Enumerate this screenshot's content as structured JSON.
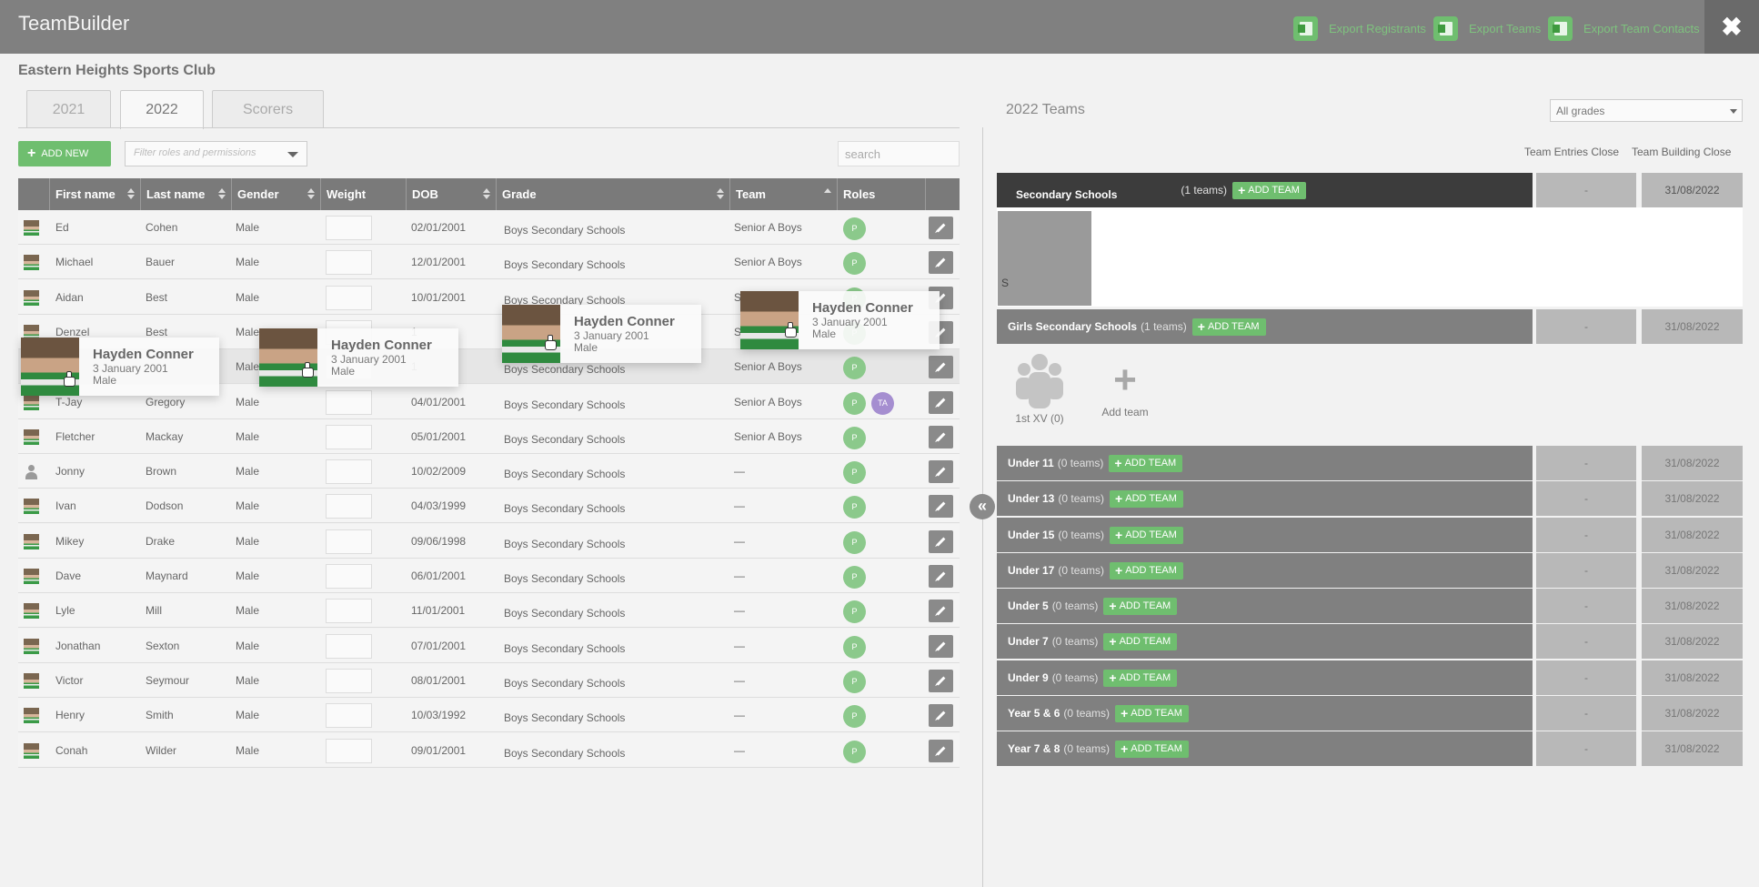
{
  "app": {
    "title": "TeamBuilder"
  },
  "header": {
    "exports": [
      "Export Registrants",
      "Export Teams",
      "Export Team Contacts"
    ],
    "close_label": "✖"
  },
  "club": {
    "name": "Eastern Heights Sports Club"
  },
  "tabs": [
    "2021",
    "2022",
    "Scorers"
  ],
  "toolbar": {
    "add_new_label": "ADD NEW",
    "filter_placeholder": "Filter roles and permissions",
    "search_placeholder": "search"
  },
  "table": {
    "columns": [
      "First name",
      "Last name",
      "Gender",
      "Weight",
      "DOB",
      "Grade",
      "Team",
      "Roles"
    ],
    "rows": [
      {
        "first": "Ed",
        "last": "Cohen",
        "gender": "Male",
        "dob": "02/01/2001",
        "grade": "Boys Secondary Schools",
        "team": "Senior A Boys",
        "roles": [
          "P"
        ]
      },
      {
        "first": "Michael",
        "last": "Bauer",
        "gender": "Male",
        "dob": "12/01/2001",
        "grade": "Boys Secondary Schools",
        "team": "Senior A Boys",
        "roles": [
          "P"
        ]
      },
      {
        "first": "Aidan",
        "last": "Best",
        "gender": "Male",
        "dob": "10/01/2001",
        "grade": "Boys Secondary Schools",
        "team": "S",
        "roles": [
          "P"
        ]
      },
      {
        "first": "Denzel",
        "last": "Best",
        "gender": "Male",
        "dob": "1",
        "grade": "",
        "team": "S",
        "roles": [
          "P"
        ]
      },
      {
        "first": "",
        "last": "",
        "gender": "Male",
        "dob": "1",
        "grade": "Boys Secondary Schools",
        "team": "Senior A Boys",
        "roles": [
          "P"
        ]
      },
      {
        "first": "T-Jay",
        "last": "Gregory",
        "gender": "Male",
        "dob": "04/01/2001",
        "grade": "Boys Secondary Schools",
        "team": "Senior A Boys",
        "roles": [
          "P",
          "TA"
        ]
      },
      {
        "first": "Fletcher",
        "last": "Mackay",
        "gender": "Male",
        "dob": "05/01/2001",
        "grade": "Boys Secondary Schools",
        "team": "Senior A Boys",
        "roles": [
          "P"
        ]
      },
      {
        "first": "Jonny",
        "last": "Brown",
        "gender": "Male",
        "dob": "10/02/2009",
        "grade": "Boys Secondary Schools",
        "team": "—",
        "roles": [
          "P"
        ]
      },
      {
        "first": "Ivan",
        "last": "Dodson",
        "gender": "Male",
        "dob": "04/03/1999",
        "grade": "Boys Secondary Schools",
        "team": "—",
        "roles": [
          "P"
        ]
      },
      {
        "first": "Mikey",
        "last": "Drake",
        "gender": "Male",
        "dob": "09/06/1998",
        "grade": "Boys Secondary Schools",
        "team": "—",
        "roles": [
          "P"
        ]
      },
      {
        "first": "Dave",
        "last": "Maynard",
        "gender": "Male",
        "dob": "06/01/2001",
        "grade": "Boys Secondary Schools",
        "team": "—",
        "roles": [
          "P"
        ]
      },
      {
        "first": "Lyle",
        "last": "Mill",
        "gender": "Male",
        "dob": "11/01/2001",
        "grade": "Boys Secondary Schools",
        "team": "—",
        "roles": [
          "P"
        ]
      },
      {
        "first": "Jonathan",
        "last": "Sexton",
        "gender": "Male",
        "dob": "07/01/2001",
        "grade": "Boys Secondary Schools",
        "team": "—",
        "roles": [
          "P"
        ]
      },
      {
        "first": "Victor",
        "last": "Seymour",
        "gender": "Male",
        "dob": "08/01/2001",
        "grade": "Boys Secondary Schools",
        "team": "—",
        "roles": [
          "P"
        ]
      },
      {
        "first": "Henry",
        "last": "Smith",
        "gender": "Male",
        "dob": "10/03/1992",
        "grade": "Boys Secondary Schools",
        "team": "—",
        "roles": [
          "P"
        ]
      },
      {
        "first": "Conah",
        "last": "Wilder",
        "gender": "Male",
        "dob": "09/01/2001",
        "grade": "Boys Secondary Schools",
        "team": "—",
        "roles": [
          "P"
        ]
      }
    ]
  },
  "drag_ghost": {
    "name": "Hayden Conner",
    "dob": "3 January 2001",
    "gender": "Male"
  },
  "teams_panel": {
    "title": "2022 Teams",
    "grade_filter": "All grades",
    "col_entries": "Team Entries Close",
    "col_building": "Team Building Close",
    "add_team_label": "ADD TEAM",
    "team_card_label": "S",
    "slot_team": "1st XV (0)",
    "slot_add": "Add team",
    "groups": [
      {
        "name": "Secondary Schools",
        "count": "(1 teams)",
        "entries": "-",
        "building": "31/08/2022"
      },
      {
        "name": "Girls Secondary Schools",
        "count": "(1 teams)",
        "entries": "-",
        "building": "31/08/2022"
      },
      {
        "name": "Under 11",
        "count": "(0 teams)",
        "entries": "-",
        "building": "31/08/2022"
      },
      {
        "name": "Under 13",
        "count": "(0 teams)",
        "entries": "-",
        "building": "31/08/2022"
      },
      {
        "name": "Under 15",
        "count": "(0 teams)",
        "entries": "-",
        "building": "31/08/2022"
      },
      {
        "name": "Under 17",
        "count": "(0 teams)",
        "entries": "-",
        "building": "31/08/2022"
      },
      {
        "name": "Under 5",
        "count": "(0 teams)",
        "entries": "-",
        "building": "31/08/2022"
      },
      {
        "name": "Under 7",
        "count": "(0 teams)",
        "entries": "-",
        "building": "31/08/2022"
      },
      {
        "name": "Under 9",
        "count": "(0 teams)",
        "entries": "-",
        "building": "31/08/2022"
      },
      {
        "name": "Year 5 & 6",
        "count": "(0 teams)",
        "entries": "-",
        "building": "31/08/2022"
      },
      {
        "name": "Year 7 & 8",
        "count": "(0 teams)",
        "entries": "-",
        "building": "31/08/2022"
      }
    ]
  },
  "icons": {
    "export": "excel-icon",
    "close": "close-icon",
    "add": "plus-icon",
    "sort": "sort-icon",
    "edit": "pencil-icon",
    "collapse": "double-chevron-left-icon",
    "drag_cursor": "hand-cursor-icon",
    "team": "people-group-icon"
  },
  "colors": {
    "accent_green": "#6fbe6f",
    "header_gray": "#808080",
    "role_player": "#8bc98b",
    "role_ta": "#a58ed0"
  }
}
